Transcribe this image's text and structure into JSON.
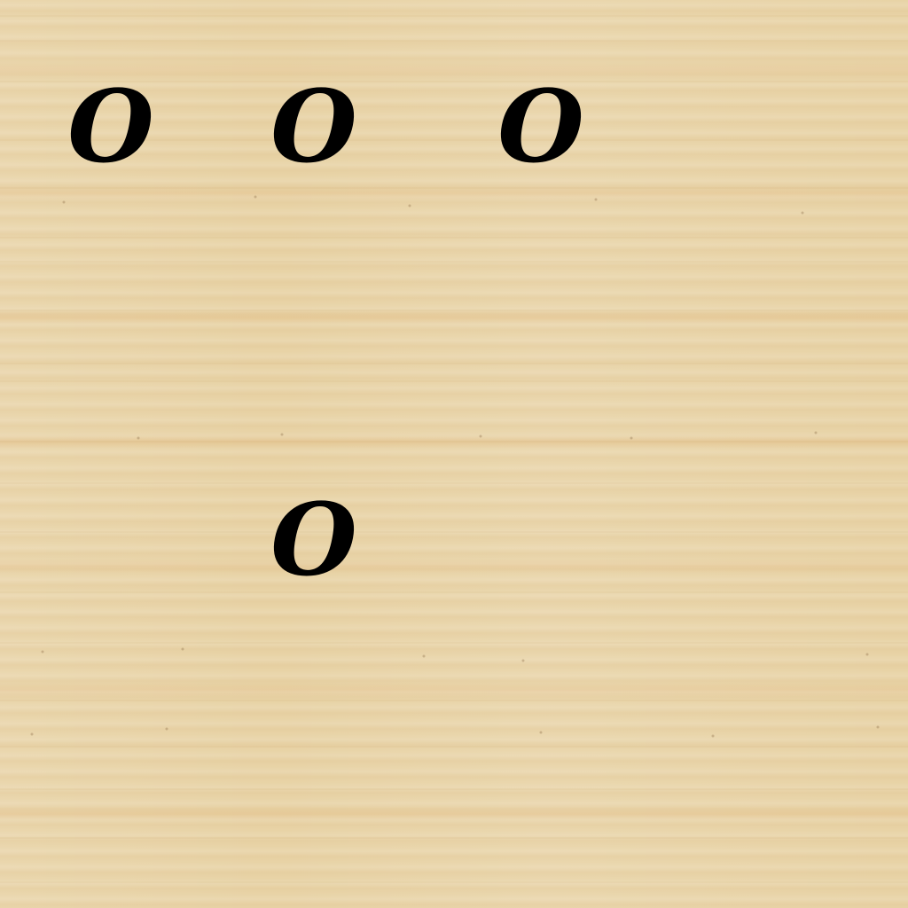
{
  "board": {
    "mark_color": "#000000",
    "wood_color": "#e8d3a6",
    "cells": [
      {
        "row": 0,
        "col": 0,
        "mark": "O"
      },
      {
        "row": 0,
        "col": 1,
        "mark": "O"
      },
      {
        "row": 0,
        "col": 2,
        "mark": "O"
      },
      {
        "row": 0,
        "col": 3,
        "mark": ""
      },
      {
        "row": 1,
        "col": 0,
        "mark": ""
      },
      {
        "row": 1,
        "col": 1,
        "mark": ""
      },
      {
        "row": 1,
        "col": 2,
        "mark": ""
      },
      {
        "row": 1,
        "col": 3,
        "mark": ""
      },
      {
        "row": 2,
        "col": 0,
        "mark": ""
      },
      {
        "row": 2,
        "col": 1,
        "mark": "O"
      },
      {
        "row": 2,
        "col": 2,
        "mark": ""
      },
      {
        "row": 2,
        "col": 3,
        "mark": ""
      }
    ]
  }
}
